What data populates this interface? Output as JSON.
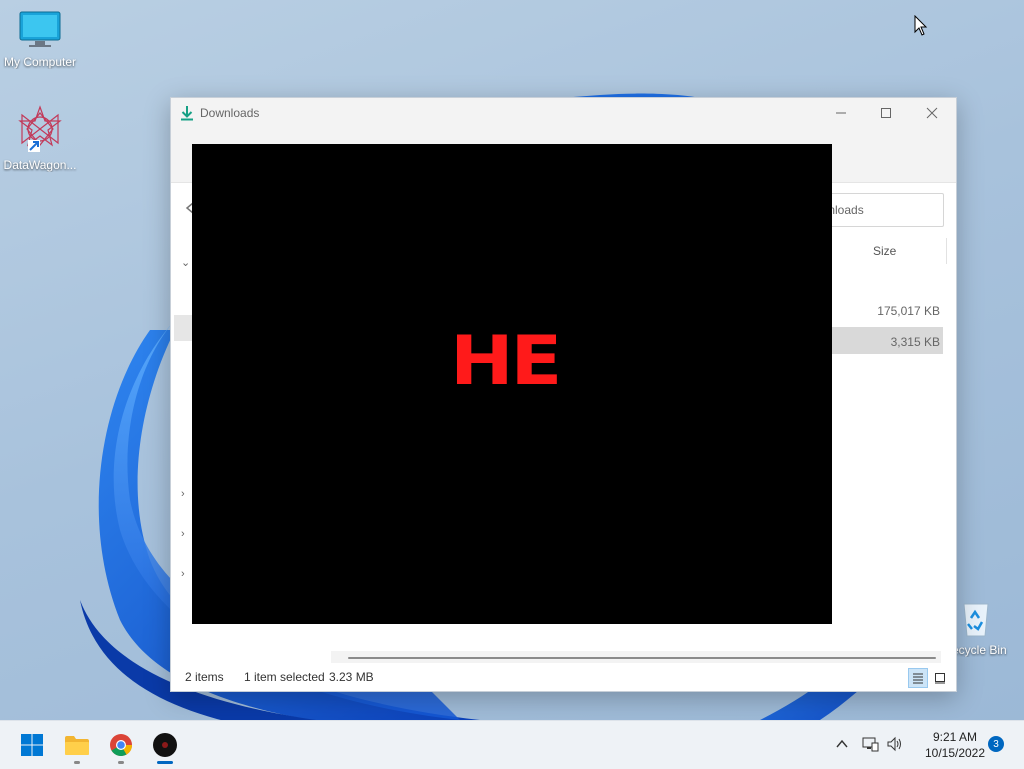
{
  "desktop": {
    "icons": [
      {
        "label": "My Computer",
        "icon": "monitor-icon"
      },
      {
        "label": "DataWagon...",
        "icon": "datawagon-app-icon"
      },
      {
        "label": "ecycle Bin",
        "icon": "recycle-bin-icon"
      }
    ]
  },
  "window": {
    "title": "Downloads",
    "address_text": "ownloads",
    "columns": {
      "size": "Size"
    },
    "rows": [
      {
        "size": "175,017 KB",
        "selected": false
      },
      {
        "size": "3,315 KB",
        "selected": true
      }
    ],
    "status": {
      "items": "2 items",
      "selected": "1 item selected",
      "selected_size": "3.23 MB"
    }
  },
  "overlay": {
    "text": "HE",
    "text_color": "#ff1a1a"
  },
  "taskbar": {
    "apps": [
      {
        "name": "start",
        "icon": "windows-start-icon"
      },
      {
        "name": "file-explorer",
        "icon": "folder-icon"
      },
      {
        "name": "chrome",
        "icon": "chrome-icon"
      },
      {
        "name": "black-app",
        "icon": "black-circle-app-icon"
      }
    ],
    "clock": {
      "time": "9:21 AM",
      "date": "10/15/2022"
    },
    "notification_count": "3"
  },
  "colors": {
    "accent": "#0067c0",
    "wallpaper_blue": "#1f6fe6"
  }
}
